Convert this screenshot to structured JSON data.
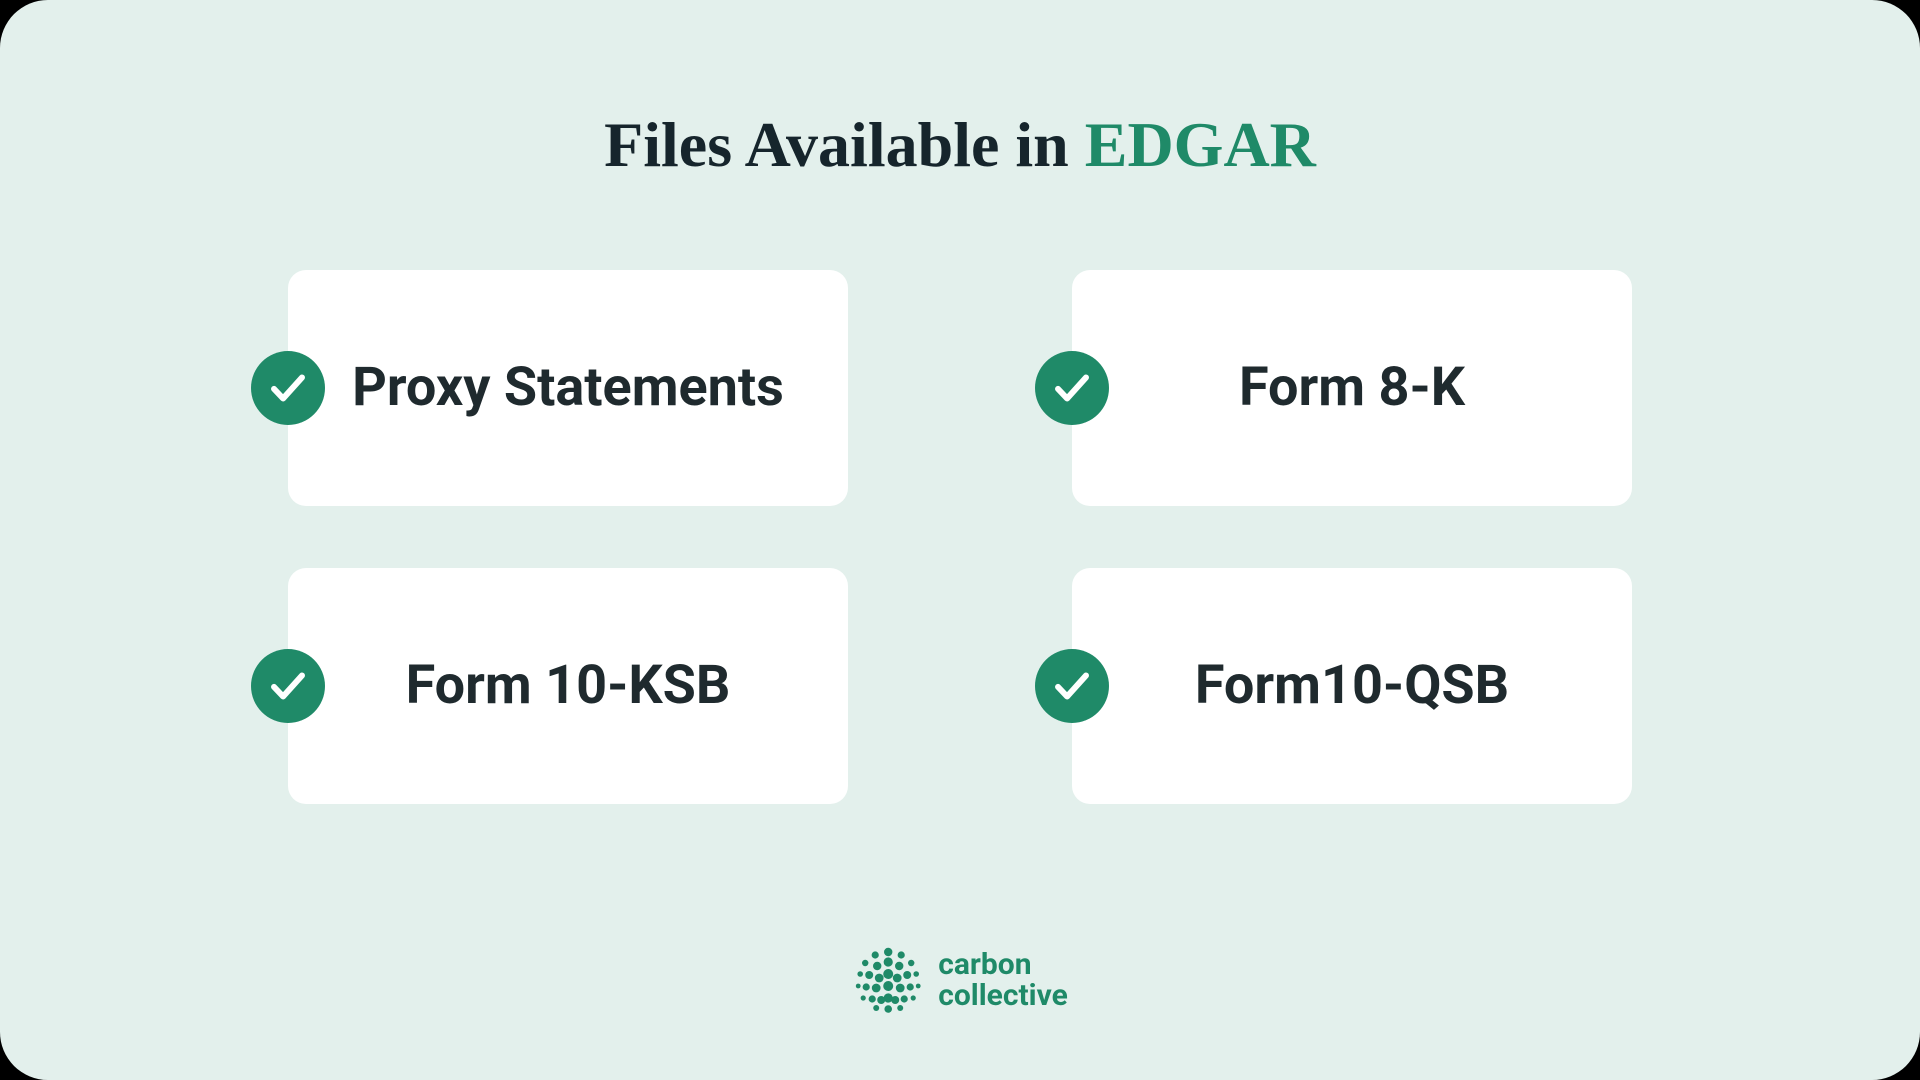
{
  "title_prefix": "Files Available in ",
  "title_highlight": "EDGAR",
  "cards": [
    {
      "label": "Proxy Statements"
    },
    {
      "label": "Form 8-K"
    },
    {
      "label": "Form 10-KSB"
    },
    {
      "label": "Form10-QSB"
    }
  ],
  "brand": {
    "line1": "carbon",
    "line2": "collective"
  },
  "colors": {
    "accent": "#1f8a68",
    "panel": "#e3f0ec",
    "card": "#ffffff",
    "text": "#1f2a2e"
  }
}
